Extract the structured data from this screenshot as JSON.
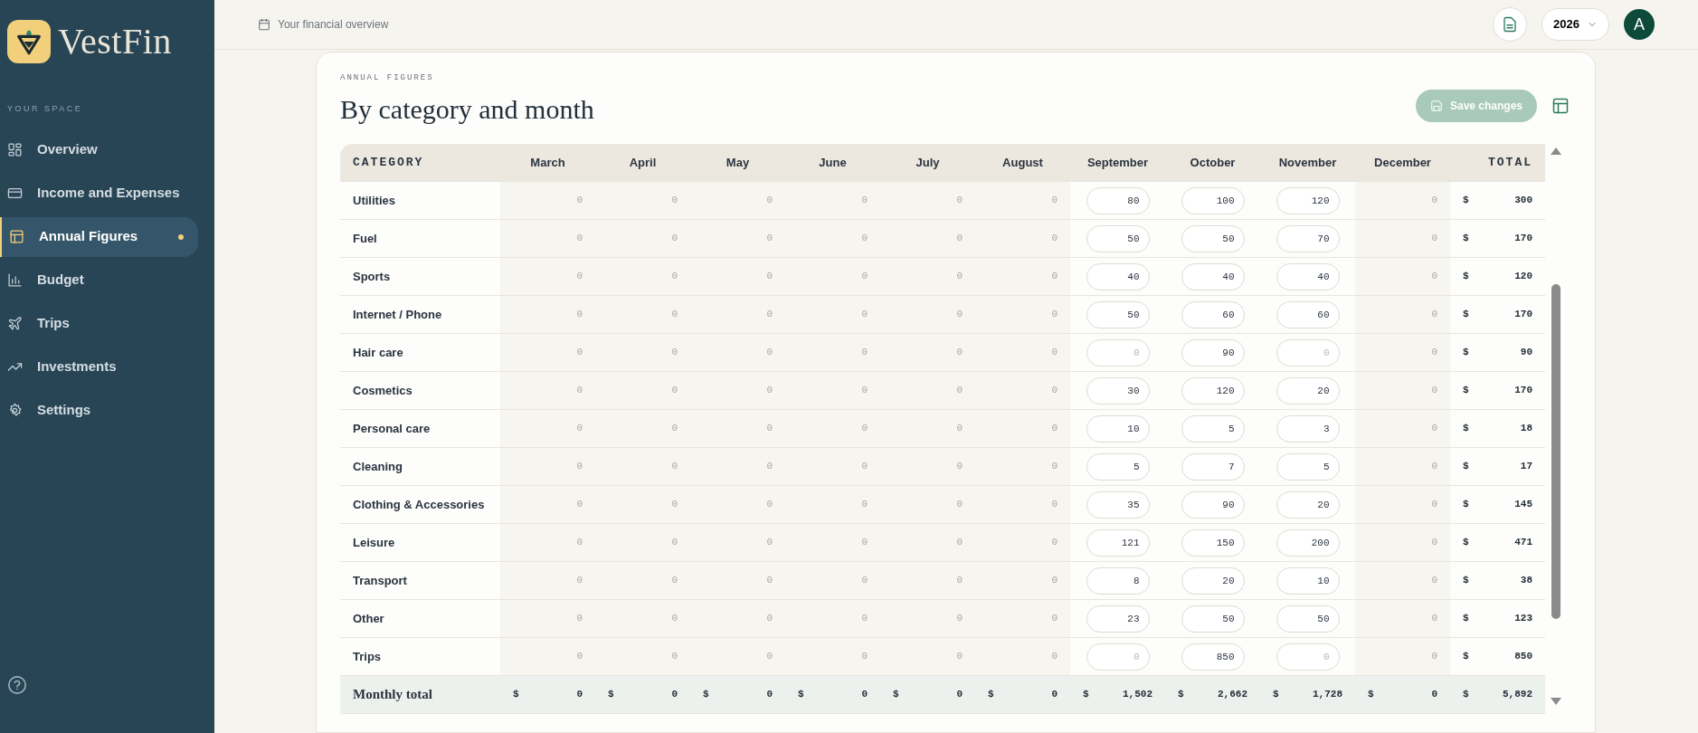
{
  "sidebar": {
    "brand": "VestFin",
    "section_label": "YOUR SPACE",
    "items": [
      {
        "label": "Overview",
        "selected": false
      },
      {
        "label": "Income and Expenses",
        "selected": false
      },
      {
        "label": "Annual Figures",
        "selected": true
      },
      {
        "label": "Budget",
        "selected": false
      },
      {
        "label": "Trips",
        "selected": false
      },
      {
        "label": "Investments",
        "selected": false
      },
      {
        "label": "Settings",
        "selected": false
      }
    ]
  },
  "header": {
    "subtitle": "Your financial overview",
    "year": "2026",
    "avatar": "A"
  },
  "card": {
    "eyebrow": "ANNUAL FIGURES",
    "title": "By category and month",
    "save_button": {
      "label": "Save changes",
      "disabled": true
    }
  },
  "table": {
    "columns": [
      {
        "label": "CATEGORY",
        "kind": "category"
      },
      {
        "label": "March",
        "kind": "fixed"
      },
      {
        "label": "April",
        "kind": "fixed"
      },
      {
        "label": "May",
        "kind": "fixed"
      },
      {
        "label": "June",
        "kind": "fixed"
      },
      {
        "label": "July",
        "kind": "fixed"
      },
      {
        "label": "August",
        "kind": "fixed"
      },
      {
        "label": "September",
        "kind": "editable"
      },
      {
        "label": "October",
        "kind": "editable"
      },
      {
        "label": "November",
        "kind": "editable"
      },
      {
        "label": "December",
        "kind": "fixed"
      },
      {
        "label": "TOTAL",
        "kind": "total"
      }
    ],
    "rows": [
      {
        "cells": [
          {
            "text": "Utilities"
          },
          {
            "value": "0"
          },
          {
            "value": "0"
          },
          {
            "value": "0"
          },
          {
            "value": "0"
          },
          {
            "value": "0"
          },
          {
            "value": "0"
          },
          {
            "value": "80"
          },
          {
            "value": "100"
          },
          {
            "value": "120"
          },
          {
            "value": "0"
          },
          {
            "currency": "$",
            "amount": "300"
          }
        ]
      },
      {
        "cells": [
          {
            "text": "Fuel"
          },
          {
            "value": "0"
          },
          {
            "value": "0"
          },
          {
            "value": "0"
          },
          {
            "value": "0"
          },
          {
            "value": "0"
          },
          {
            "value": "0"
          },
          {
            "value": "50"
          },
          {
            "value": "50"
          },
          {
            "value": "70"
          },
          {
            "value": "0"
          },
          {
            "currency": "$",
            "amount": "170"
          }
        ]
      },
      {
        "cells": [
          {
            "text": "Sports"
          },
          {
            "value": "0"
          },
          {
            "value": "0"
          },
          {
            "value": "0"
          },
          {
            "value": "0"
          },
          {
            "value": "0"
          },
          {
            "value": "0"
          },
          {
            "value": "40"
          },
          {
            "value": "40"
          },
          {
            "value": "40"
          },
          {
            "value": "0"
          },
          {
            "currency": "$",
            "amount": "120"
          }
        ]
      },
      {
        "cells": [
          {
            "text": "Internet / Phone"
          },
          {
            "value": "0"
          },
          {
            "value": "0"
          },
          {
            "value": "0"
          },
          {
            "value": "0"
          },
          {
            "value": "0"
          },
          {
            "value": "0"
          },
          {
            "value": "50"
          },
          {
            "value": "60"
          },
          {
            "value": "60"
          },
          {
            "value": "0"
          },
          {
            "currency": "$",
            "amount": "170"
          }
        ]
      },
      {
        "cells": [
          {
            "text": "Hair care"
          },
          {
            "value": "0"
          },
          {
            "value": "0"
          },
          {
            "value": "0"
          },
          {
            "value": "0"
          },
          {
            "value": "0"
          },
          {
            "value": "0"
          },
          {
            "placeholder": "0"
          },
          {
            "value": "90"
          },
          {
            "placeholder": "0"
          },
          {
            "value": "0"
          },
          {
            "currency": "$",
            "amount": "90"
          }
        ]
      },
      {
        "cells": [
          {
            "text": "Cosmetics"
          },
          {
            "value": "0"
          },
          {
            "value": "0"
          },
          {
            "value": "0"
          },
          {
            "value": "0"
          },
          {
            "value": "0"
          },
          {
            "value": "0"
          },
          {
            "value": "30"
          },
          {
            "value": "120"
          },
          {
            "value": "20"
          },
          {
            "value": "0"
          },
          {
            "currency": "$",
            "amount": "170"
          }
        ]
      },
      {
        "cells": [
          {
            "text": "Personal care"
          },
          {
            "value": "0"
          },
          {
            "value": "0"
          },
          {
            "value": "0"
          },
          {
            "value": "0"
          },
          {
            "value": "0"
          },
          {
            "value": "0"
          },
          {
            "value": "10"
          },
          {
            "value": "5"
          },
          {
            "value": "3"
          },
          {
            "value": "0"
          },
          {
            "currency": "$",
            "amount": "18"
          }
        ]
      },
      {
        "cells": [
          {
            "text": "Cleaning"
          },
          {
            "value": "0"
          },
          {
            "value": "0"
          },
          {
            "value": "0"
          },
          {
            "value": "0"
          },
          {
            "value": "0"
          },
          {
            "value": "0"
          },
          {
            "value": "5"
          },
          {
            "value": "7"
          },
          {
            "value": "5"
          },
          {
            "value": "0"
          },
          {
            "currency": "$",
            "amount": "17"
          }
        ]
      },
      {
        "cells": [
          {
            "text": "Clothing & Accessories"
          },
          {
            "value": "0"
          },
          {
            "value": "0"
          },
          {
            "value": "0"
          },
          {
            "value": "0"
          },
          {
            "value": "0"
          },
          {
            "value": "0"
          },
          {
            "value": "35"
          },
          {
            "value": "90"
          },
          {
            "value": "20"
          },
          {
            "value": "0"
          },
          {
            "currency": "$",
            "amount": "145"
          }
        ]
      },
      {
        "cells": [
          {
            "text": "Leisure"
          },
          {
            "value": "0"
          },
          {
            "value": "0"
          },
          {
            "value": "0"
          },
          {
            "value": "0"
          },
          {
            "value": "0"
          },
          {
            "value": "0"
          },
          {
            "value": "121"
          },
          {
            "value": "150"
          },
          {
            "value": "200"
          },
          {
            "value": "0"
          },
          {
            "currency": "$",
            "amount": "471"
          }
        ]
      },
      {
        "cells": [
          {
            "text": "Transport"
          },
          {
            "value": "0"
          },
          {
            "value": "0"
          },
          {
            "value": "0"
          },
          {
            "value": "0"
          },
          {
            "value": "0"
          },
          {
            "value": "0"
          },
          {
            "value": "8"
          },
          {
            "value": "20"
          },
          {
            "value": "10"
          },
          {
            "value": "0"
          },
          {
            "currency": "$",
            "amount": "38"
          }
        ]
      },
      {
        "cells": [
          {
            "text": "Other"
          },
          {
            "value": "0"
          },
          {
            "value": "0"
          },
          {
            "value": "0"
          },
          {
            "value": "0"
          },
          {
            "value": "0"
          },
          {
            "value": "0"
          },
          {
            "value": "23"
          },
          {
            "value": "50"
          },
          {
            "value": "50"
          },
          {
            "value": "0"
          },
          {
            "currency": "$",
            "amount": "123"
          }
        ]
      },
      {
        "cells": [
          {
            "text": "Trips"
          },
          {
            "value": "0"
          },
          {
            "value": "0"
          },
          {
            "value": "0"
          },
          {
            "value": "0"
          },
          {
            "value": "0"
          },
          {
            "value": "0"
          },
          {
            "placeholder": "0"
          },
          {
            "value": "850"
          },
          {
            "placeholder": "0"
          },
          {
            "value": "0"
          },
          {
            "currency": "$",
            "amount": "850"
          }
        ]
      },
      {
        "kind": "footer",
        "cells": [
          {
            "text": "Monthly total"
          },
          {
            "currency": "$",
            "amount": "0"
          },
          {
            "currency": "$",
            "amount": "0"
          },
          {
            "currency": "$",
            "amount": "0"
          },
          {
            "currency": "$",
            "amount": "0"
          },
          {
            "currency": "$",
            "amount": "0"
          },
          {
            "currency": "$",
            "amount": "0"
          },
          {
            "currency": "$",
            "amount": "1,502"
          },
          {
            "currency": "$",
            "amount": "2,662"
          },
          {
            "currency": "$",
            "amount": "1,728"
          },
          {
            "currency": "$",
            "amount": "0"
          },
          {
            "currency": "$",
            "amount": "5,892"
          }
        ]
      }
    ]
  }
}
